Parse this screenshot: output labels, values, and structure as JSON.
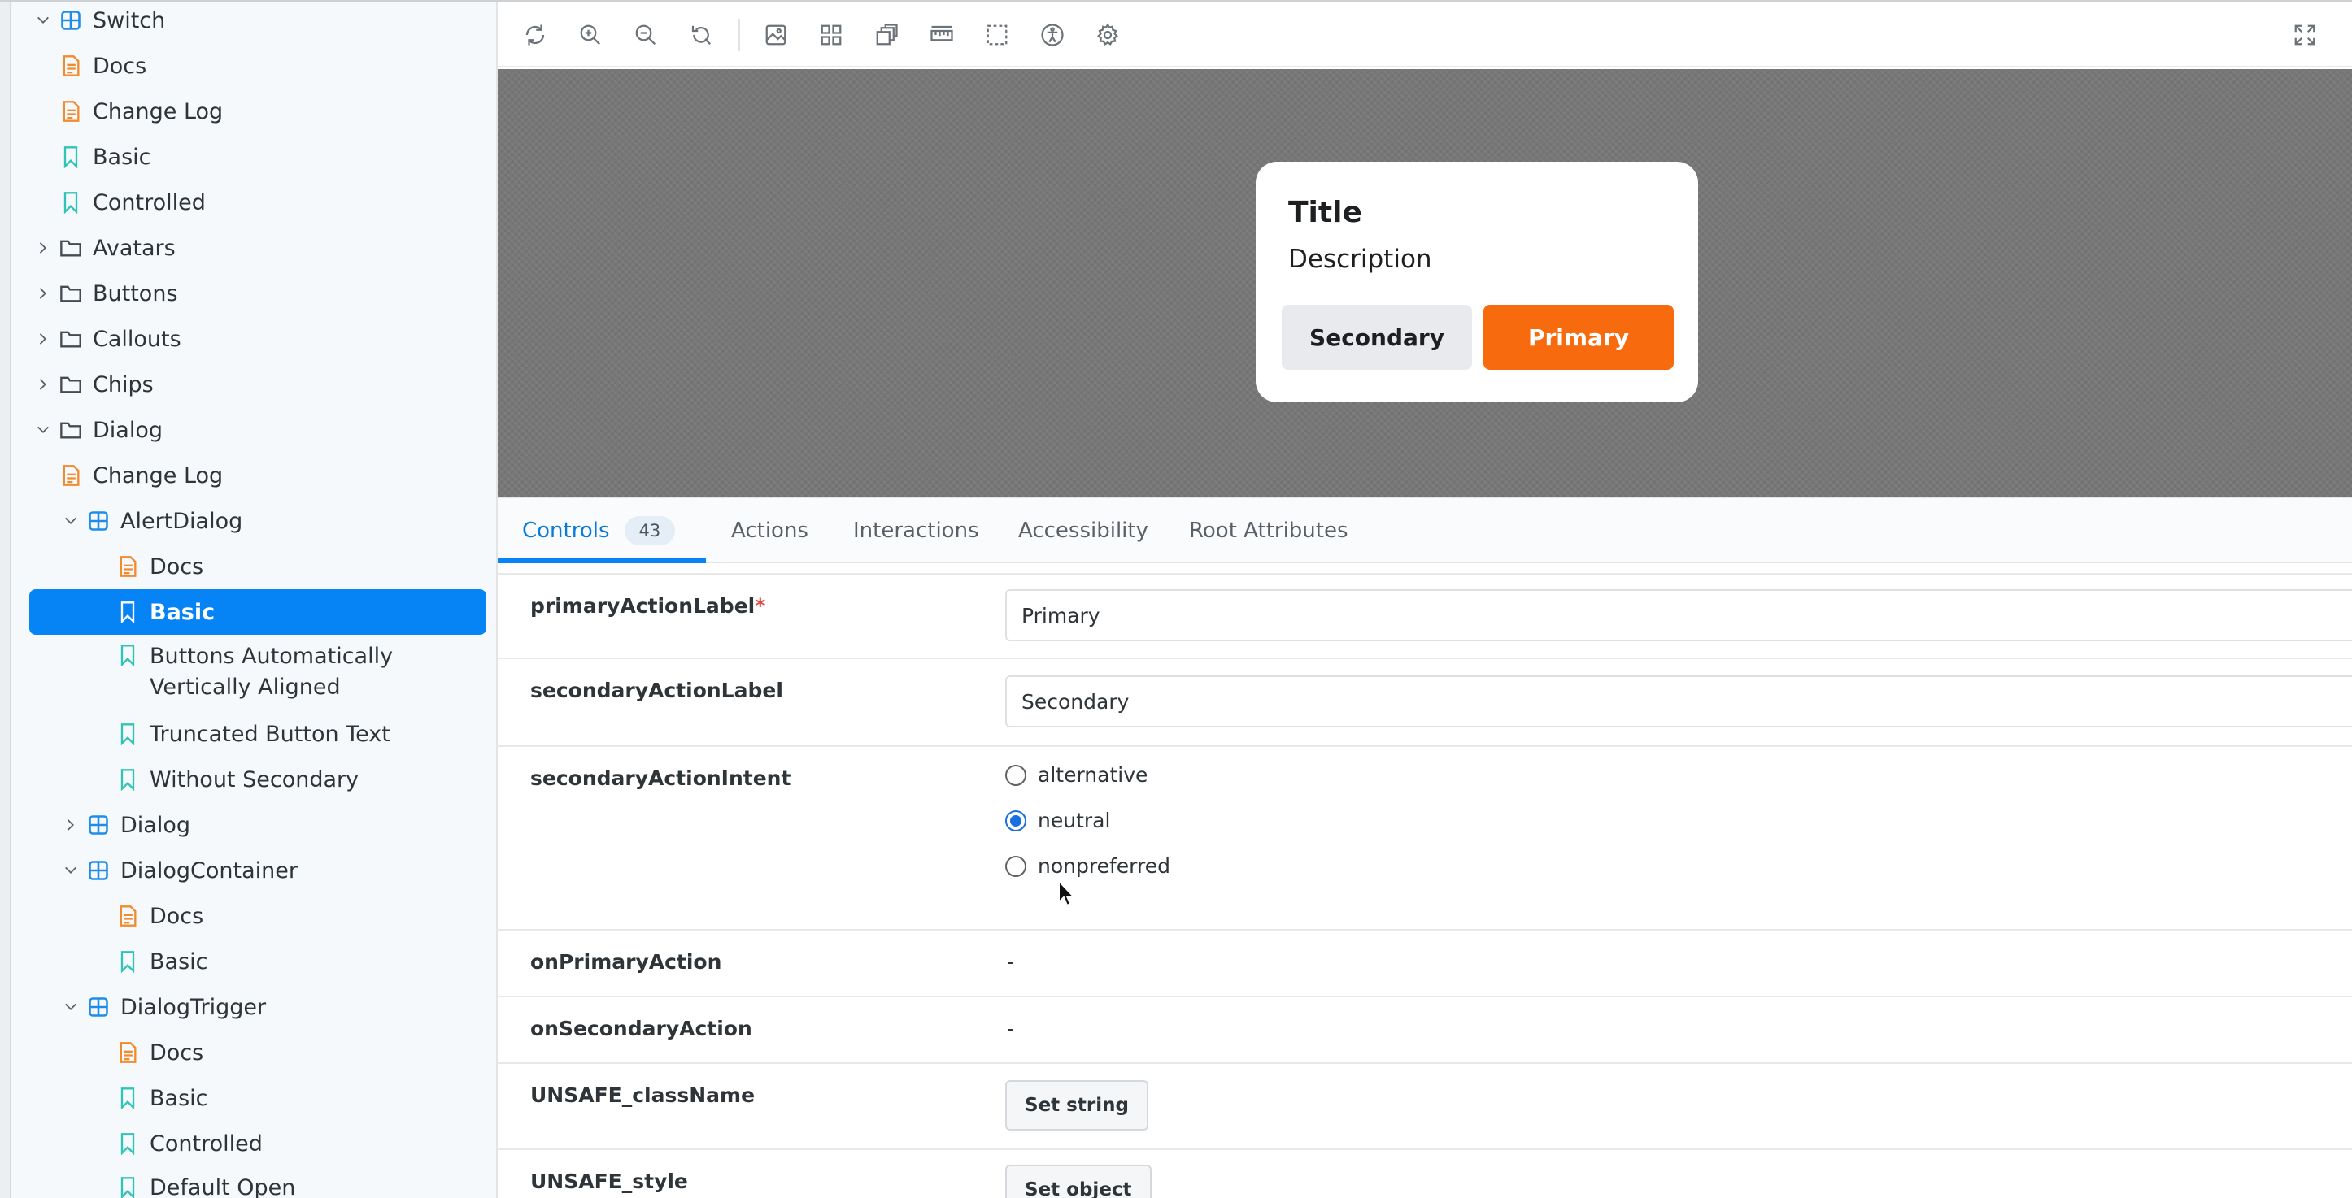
{
  "sidebar": {
    "items": [
      {
        "label": "Switch",
        "type": "component",
        "expanded": true
      },
      {
        "label": "Docs",
        "type": "doc"
      },
      {
        "label": "Change Log",
        "type": "doc"
      },
      {
        "label": "Basic",
        "type": "story"
      },
      {
        "label": "Controlled",
        "type": "story"
      },
      {
        "label": "Avatars",
        "type": "folder",
        "expanded": false
      },
      {
        "label": "Buttons",
        "type": "folder",
        "expanded": false
      },
      {
        "label": "Callouts",
        "type": "folder",
        "expanded": false
      },
      {
        "label": "Chips",
        "type": "folder",
        "expanded": false
      },
      {
        "label": "Dialog",
        "type": "folder",
        "expanded": true
      },
      {
        "label": "Change Log",
        "type": "doc"
      },
      {
        "label": "AlertDialog",
        "type": "component",
        "expanded": true
      },
      {
        "label": "Docs",
        "type": "doc"
      },
      {
        "label": "Basic",
        "type": "story",
        "selected": true
      },
      {
        "label": "Buttons Automatically Vertically Aligned",
        "type": "story"
      },
      {
        "label": "Truncated Button Text",
        "type": "story"
      },
      {
        "label": "Without Secondary",
        "type": "story"
      },
      {
        "label": "Dialog",
        "type": "component",
        "expanded": false
      },
      {
        "label": "DialogContainer",
        "type": "component",
        "expanded": true
      },
      {
        "label": "Docs",
        "type": "doc"
      },
      {
        "label": "Basic",
        "type": "story"
      },
      {
        "label": "DialogTrigger",
        "type": "component",
        "expanded": true
      },
      {
        "label": "Docs",
        "type": "doc"
      },
      {
        "label": "Basic",
        "type": "story"
      },
      {
        "label": "Controlled",
        "type": "story"
      },
      {
        "label": "Default Open",
        "type": "story"
      }
    ]
  },
  "toolbar": {
    "icons": [
      "reload-icon",
      "zoom-in-icon",
      "zoom-out-icon",
      "zoom-reset-icon",
      "background-icon",
      "grid-icon",
      "outline-icon",
      "measure-icon",
      "viewport-icon",
      "accessibility-icon",
      "settings-icon",
      "fullscreen-icon"
    ]
  },
  "preview": {
    "dialog": {
      "title": "Title",
      "description": "Description",
      "secondary_label": "Secondary",
      "primary_label": "Primary"
    }
  },
  "tabs": {
    "controls": "Controls",
    "controls_count": "43",
    "actions": "Actions",
    "interactions": "Interactions",
    "accessibility": "Accessibility",
    "root_attributes": "Root Attributes"
  },
  "controls": {
    "primaryActionLabel": {
      "name": "primaryActionLabel",
      "required": "*",
      "value": "Primary"
    },
    "secondaryActionLabel": {
      "name": "secondaryActionLabel",
      "value": "Secondary"
    },
    "secondaryActionIntent": {
      "name": "secondaryActionIntent",
      "options": [
        "alternative",
        "neutral",
        "nonpreferred"
      ],
      "selected": "neutral"
    },
    "onPrimaryAction": {
      "name": "onPrimaryAction",
      "value": "-"
    },
    "onSecondaryAction": {
      "name": "onSecondaryAction",
      "value": "-"
    },
    "UNSAFE_className": {
      "name": "UNSAFE_className",
      "button": "Set string"
    },
    "UNSAFE_style": {
      "name": "UNSAFE_style",
      "button": "Set object"
    }
  },
  "colors": {
    "accent": "#0683f5",
    "primary_button": "#f76a0e",
    "doc_icon": "#f28a2e",
    "story_icon": "#2fc4b4",
    "component_icon": "#1f8de8",
    "folder_icon": "#444c52"
  }
}
